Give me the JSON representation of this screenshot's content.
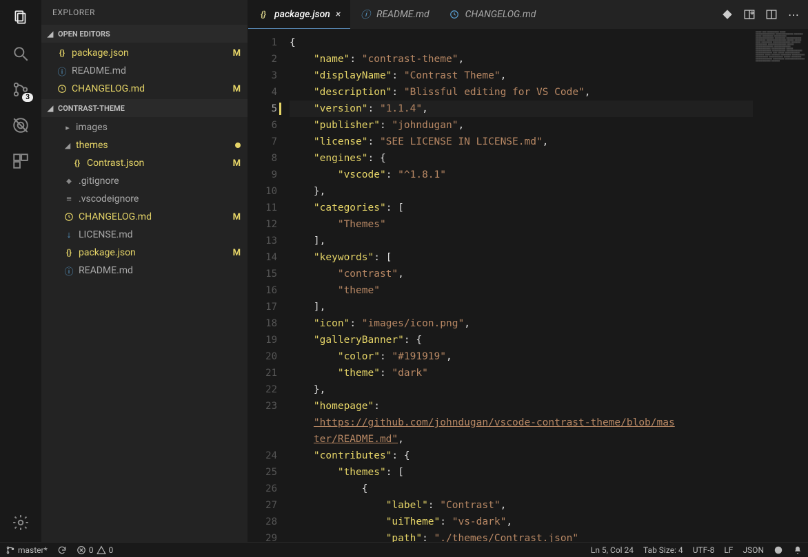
{
  "sidebar": {
    "title": "EXPLORER",
    "sections": {
      "openEditors": {
        "label": "OPEN EDITORS",
        "items": [
          {
            "label": "package.json",
            "icon": "json",
            "modified": "M"
          },
          {
            "label": "README.md",
            "icon": "info",
            "modified": ""
          },
          {
            "label": "CHANGELOG.md",
            "icon": "clock",
            "modified": "M"
          }
        ]
      },
      "project": {
        "label": "CONTRAST-THEME",
        "items": [
          {
            "label": "images",
            "type": "folder",
            "expanded": false
          },
          {
            "label": "themes",
            "type": "folder",
            "expanded": true,
            "status": "dot"
          },
          {
            "label": "Contrast.json",
            "type": "file",
            "icon": "json",
            "modified": "M",
            "indent": 3
          },
          {
            "label": ".gitignore",
            "type": "file",
            "icon": "git"
          },
          {
            "label": ".vscodeignore",
            "type": "file",
            "icon": "lines"
          },
          {
            "label": "CHANGELOG.md",
            "type": "file",
            "icon": "clock",
            "modified": "M"
          },
          {
            "label": "LICENSE.md",
            "type": "file",
            "icon": "arrow"
          },
          {
            "label": "package.json",
            "type": "file",
            "icon": "json",
            "modified": "M"
          },
          {
            "label": "README.md",
            "type": "file",
            "icon": "info"
          }
        ]
      }
    }
  },
  "tabs": [
    {
      "label": "package.json",
      "icon": "json",
      "active": true
    },
    {
      "label": "README.md",
      "icon": "info",
      "active": false
    },
    {
      "label": "CHANGELOG.md",
      "icon": "clock",
      "active": false
    }
  ],
  "scmBadge": "3",
  "editor": {
    "lines": [
      {
        "n": 1,
        "segs": [
          {
            "c": "tok-p",
            "t": "{"
          }
        ]
      },
      {
        "n": 2,
        "segs": [
          {
            "c": "",
            "t": "    "
          },
          {
            "c": "tok-k",
            "t": "\"name\""
          },
          {
            "c": "tok-p",
            "t": ": "
          },
          {
            "c": "tok-s",
            "t": "\"contrast-theme\""
          },
          {
            "c": "tok-p",
            "t": ","
          }
        ]
      },
      {
        "n": 3,
        "segs": [
          {
            "c": "",
            "t": "    "
          },
          {
            "c": "tok-k",
            "t": "\"displayName\""
          },
          {
            "c": "tok-p",
            "t": ": "
          },
          {
            "c": "tok-s",
            "t": "\"Contrast Theme\""
          },
          {
            "c": "tok-p",
            "t": ","
          }
        ]
      },
      {
        "n": 4,
        "segs": [
          {
            "c": "",
            "t": "    "
          },
          {
            "c": "tok-k",
            "t": "\"description\""
          },
          {
            "c": "tok-p",
            "t": ": "
          },
          {
            "c": "tok-s",
            "t": "\"Blissful editing for VS Code\""
          },
          {
            "c": "tok-p",
            "t": ","
          }
        ]
      },
      {
        "n": 5,
        "hl": true,
        "segs": [
          {
            "c": "",
            "t": "    "
          },
          {
            "c": "tok-k",
            "t": "\"version\""
          },
          {
            "c": "tok-p",
            "t": ": "
          },
          {
            "c": "tok-s",
            "t": "\"1.1.4\""
          },
          {
            "c": "tok-p",
            "t": ","
          }
        ]
      },
      {
        "n": 6,
        "segs": [
          {
            "c": "",
            "t": "    "
          },
          {
            "c": "tok-k",
            "t": "\"publisher\""
          },
          {
            "c": "tok-p",
            "t": ": "
          },
          {
            "c": "tok-s",
            "t": "\"johndugan\""
          },
          {
            "c": "tok-p",
            "t": ","
          }
        ]
      },
      {
        "n": 7,
        "segs": [
          {
            "c": "",
            "t": "    "
          },
          {
            "c": "tok-k",
            "t": "\"license\""
          },
          {
            "c": "tok-p",
            "t": ": "
          },
          {
            "c": "tok-s",
            "t": "\"SEE LICENSE IN LICENSE.md\""
          },
          {
            "c": "tok-p",
            "t": ","
          }
        ]
      },
      {
        "n": 8,
        "segs": [
          {
            "c": "",
            "t": "    "
          },
          {
            "c": "tok-k",
            "t": "\"engines\""
          },
          {
            "c": "tok-p",
            "t": ": {"
          }
        ]
      },
      {
        "n": 9,
        "segs": [
          {
            "c": "",
            "t": "        "
          },
          {
            "c": "tok-k",
            "t": "\"vscode\""
          },
          {
            "c": "tok-p",
            "t": ": "
          },
          {
            "c": "tok-s",
            "t": "\"^1.8.1\""
          }
        ]
      },
      {
        "n": 10,
        "segs": [
          {
            "c": "",
            "t": "    "
          },
          {
            "c": "tok-p",
            "t": "},"
          }
        ]
      },
      {
        "n": 11,
        "segs": [
          {
            "c": "",
            "t": "    "
          },
          {
            "c": "tok-k",
            "t": "\"categories\""
          },
          {
            "c": "tok-p",
            "t": ": ["
          }
        ]
      },
      {
        "n": 12,
        "segs": [
          {
            "c": "",
            "t": "        "
          },
          {
            "c": "tok-s",
            "t": "\"Themes\""
          }
        ]
      },
      {
        "n": 13,
        "segs": [
          {
            "c": "",
            "t": "    "
          },
          {
            "c": "tok-p",
            "t": "],"
          }
        ]
      },
      {
        "n": 14,
        "segs": [
          {
            "c": "",
            "t": "    "
          },
          {
            "c": "tok-k",
            "t": "\"keywords\""
          },
          {
            "c": "tok-p",
            "t": ": ["
          }
        ]
      },
      {
        "n": 15,
        "segs": [
          {
            "c": "",
            "t": "        "
          },
          {
            "c": "tok-s",
            "t": "\"contrast\""
          },
          {
            "c": "tok-p",
            "t": ","
          }
        ]
      },
      {
        "n": 16,
        "segs": [
          {
            "c": "",
            "t": "        "
          },
          {
            "c": "tok-s",
            "t": "\"theme\""
          }
        ]
      },
      {
        "n": 17,
        "segs": [
          {
            "c": "",
            "t": "    "
          },
          {
            "c": "tok-p",
            "t": "],"
          }
        ]
      },
      {
        "n": 18,
        "segs": [
          {
            "c": "",
            "t": "    "
          },
          {
            "c": "tok-k",
            "t": "\"icon\""
          },
          {
            "c": "tok-p",
            "t": ": "
          },
          {
            "c": "tok-s",
            "t": "\"images/icon.png\""
          },
          {
            "c": "tok-p",
            "t": ","
          }
        ]
      },
      {
        "n": 19,
        "segs": [
          {
            "c": "",
            "t": "    "
          },
          {
            "c": "tok-k",
            "t": "\"galleryBanner\""
          },
          {
            "c": "tok-p",
            "t": ": {"
          }
        ]
      },
      {
        "n": 20,
        "segs": [
          {
            "c": "",
            "t": "        "
          },
          {
            "c": "tok-k",
            "t": "\"color\""
          },
          {
            "c": "tok-p",
            "t": ": "
          },
          {
            "c": "tok-s",
            "t": "\"#191919\""
          },
          {
            "c": "tok-p",
            "t": ","
          }
        ]
      },
      {
        "n": 21,
        "segs": [
          {
            "c": "",
            "t": "        "
          },
          {
            "c": "tok-k",
            "t": "\"theme\""
          },
          {
            "c": "tok-p",
            "t": ": "
          },
          {
            "c": "tok-s",
            "t": "\"dark\""
          }
        ]
      },
      {
        "n": 22,
        "segs": [
          {
            "c": "",
            "t": "    "
          },
          {
            "c": "tok-p",
            "t": "},"
          }
        ]
      },
      {
        "n": 23,
        "segs": [
          {
            "c": "",
            "t": "    "
          },
          {
            "c": "tok-k",
            "t": "\"homepage\""
          },
          {
            "c": "tok-p",
            "t": ":"
          }
        ]
      },
      {
        "n": "23b",
        "segs": [
          {
            "c": "",
            "t": "    "
          },
          {
            "c": "tok-u",
            "t": "\"https://github.com/johndugan/vscode-contrast-theme/blob/mas"
          }
        ]
      },
      {
        "n": "23c",
        "segs": [
          {
            "c": "",
            "t": "    "
          },
          {
            "c": "tok-u",
            "t": "ter/README.md\""
          },
          {
            "c": "tok-p",
            "t": ","
          }
        ]
      },
      {
        "n": 24,
        "segs": [
          {
            "c": "",
            "t": "    "
          },
          {
            "c": "tok-k",
            "t": "\"contributes\""
          },
          {
            "c": "tok-p",
            "t": ": {"
          }
        ]
      },
      {
        "n": 25,
        "segs": [
          {
            "c": "",
            "t": "        "
          },
          {
            "c": "tok-k",
            "t": "\"themes\""
          },
          {
            "c": "tok-p",
            "t": ": ["
          }
        ]
      },
      {
        "n": 26,
        "segs": [
          {
            "c": "",
            "t": "            "
          },
          {
            "c": "tok-p",
            "t": "{"
          }
        ]
      },
      {
        "n": 27,
        "segs": [
          {
            "c": "",
            "t": "                "
          },
          {
            "c": "tok-k",
            "t": "\"label\""
          },
          {
            "c": "tok-p",
            "t": ": "
          },
          {
            "c": "tok-s",
            "t": "\"Contrast\""
          },
          {
            "c": "tok-p",
            "t": ","
          }
        ]
      },
      {
        "n": 28,
        "segs": [
          {
            "c": "",
            "t": "                "
          },
          {
            "c": "tok-k",
            "t": "\"uiTheme\""
          },
          {
            "c": "tok-p",
            "t": ": "
          },
          {
            "c": "tok-s",
            "t": "\"vs-dark\""
          },
          {
            "c": "tok-p",
            "t": ","
          }
        ]
      },
      {
        "n": 29,
        "segs": [
          {
            "c": "",
            "t": "                "
          },
          {
            "c": "tok-k",
            "t": "\"path\""
          },
          {
            "c": "tok-p",
            "t": ": "
          },
          {
            "c": "tok-s",
            "t": "\"./themes/Contrast.json\""
          }
        ]
      }
    ]
  },
  "statusBar": {
    "branch": "master*",
    "errors": "0",
    "warnings": "0",
    "cursor": "Ln 5, Col 24",
    "tabSize": "Tab Size: 4",
    "encoding": "UTF-8",
    "eol": "LF",
    "lang": "JSON"
  }
}
